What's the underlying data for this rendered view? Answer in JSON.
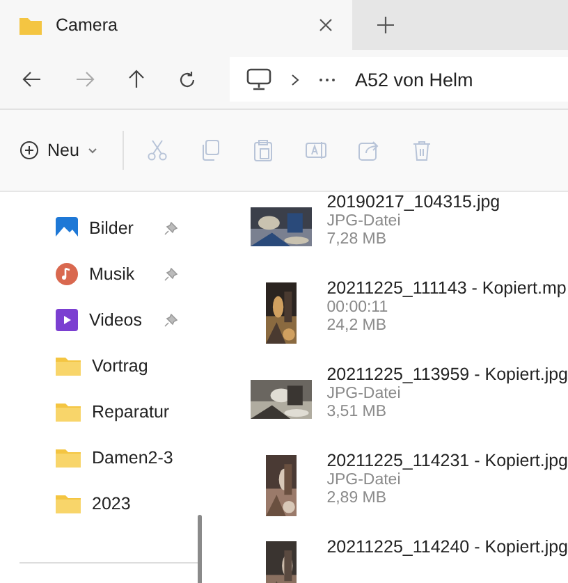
{
  "tabs": [
    {
      "title": "Camera",
      "selected": true
    }
  ],
  "address": {
    "path": "A52 von Helm"
  },
  "toolbar": {
    "new_label": "Neu",
    "actions": [
      {
        "kind": "cut",
        "disabled": true
      },
      {
        "kind": "copy",
        "disabled": true
      },
      {
        "kind": "paste",
        "disabled": true
      },
      {
        "kind": "rename",
        "disabled": true
      },
      {
        "kind": "share",
        "disabled": true
      },
      {
        "kind": "delete",
        "disabled": true
      }
    ]
  },
  "sidebar": {
    "items": [
      {
        "label": "Bilder",
        "kind": "pictures",
        "pinned": true
      },
      {
        "label": "Musik",
        "kind": "music",
        "pinned": true
      },
      {
        "label": "Videos",
        "kind": "videos",
        "pinned": true
      },
      {
        "label": "Vortrag",
        "kind": "folder",
        "pinned": false
      },
      {
        "label": "Reparatur",
        "kind": "folder",
        "pinned": false
      },
      {
        "label": "Damen2-3",
        "kind": "folder",
        "pinned": false
      },
      {
        "label": "2023",
        "kind": "folder",
        "pinned": false
      }
    ]
  },
  "files": [
    {
      "name": "20190217_104315.jpg",
      "detail": "JPG-Datei",
      "size": "7,28 MB",
      "kind": "landscape"
    },
    {
      "name": "20211225_111143 - Kopiert.mp",
      "detail": "00:00:11",
      "size": "24,2 MB",
      "kind": "portrait"
    },
    {
      "name": "20211225_113959 - Kopiert.jpg",
      "detail": "JPG-Datei",
      "size": "3,51 MB",
      "kind": "landscape"
    },
    {
      "name": "20211225_114231 - Kopiert.jpg",
      "detail": "JPG-Datei",
      "size": "2,89 MB",
      "kind": "portrait"
    },
    {
      "name": "20211225_114240 - Kopiert.jpg",
      "kind": "portrait"
    }
  ]
}
